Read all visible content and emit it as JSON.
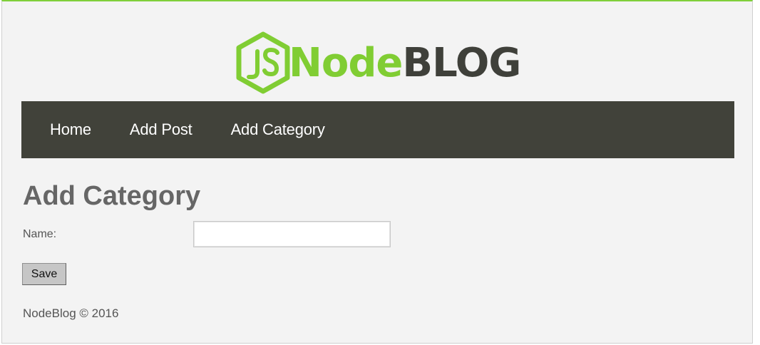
{
  "brand": {
    "logo_prefix": "JS",
    "logo_node": "Node",
    "logo_blog": "BLOG",
    "green": "#80cd33",
    "dark": "#3f403a"
  },
  "nav": {
    "items": [
      {
        "label": "Home"
      },
      {
        "label": "Add Post"
      },
      {
        "label": "Add Category"
      }
    ],
    "background": "#41423a"
  },
  "main": {
    "title": "Add Category",
    "form": {
      "name_label": "Name:",
      "name_value": "",
      "save_label": "Save"
    }
  },
  "footer": {
    "text": "NodeBlog © 2016"
  }
}
